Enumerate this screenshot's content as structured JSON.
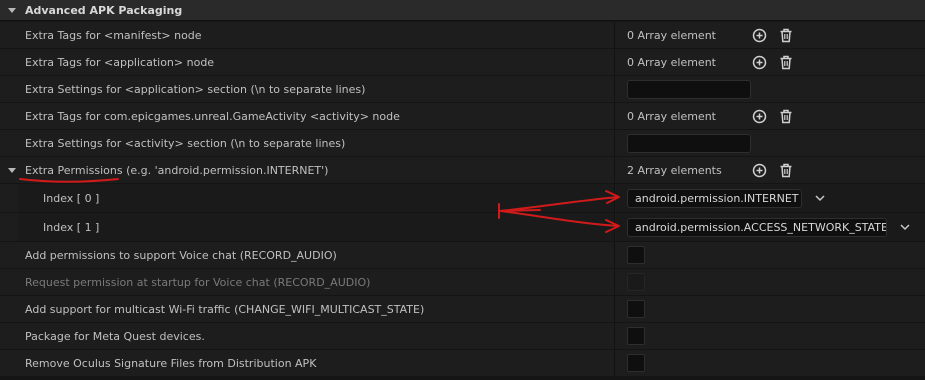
{
  "section": {
    "title": "Advanced APK Packaging"
  },
  "rows": {
    "manifest_tags": {
      "label": "Extra Tags for <manifest> node",
      "count": "0 Array element"
    },
    "application_tags": {
      "label": "Extra Tags for <application> node",
      "count": "0 Array element"
    },
    "application_settings": {
      "label": "Extra Settings for <application> section (\\n to separate lines)",
      "value": ""
    },
    "activity_tags": {
      "label": "Extra Tags for com.epicgames.unreal.GameActivity <activity> node",
      "count": "0 Array element"
    },
    "activity_settings": {
      "label": "Extra Settings for <activity> section (\\n to separate lines)",
      "value": ""
    },
    "extra_permissions": {
      "label": "Extra Permissions",
      "hint": " (e.g. 'android.permission.INTERNET')",
      "count": "2 Array elements",
      "items": [
        {
          "index_label": "Index [ 0 ]",
          "value": "android.permission.INTERNET"
        },
        {
          "index_label": "Index [ 1 ]",
          "value": "android.permission.ACCESS_NETWORK_STATE"
        }
      ]
    },
    "voice_chat": {
      "label": "Add permissions to support Voice chat (RECORD_AUDIO)",
      "checked": false
    },
    "voice_chat_startup": {
      "label": "Request permission at startup for Voice chat (RECORD_AUDIO)",
      "checked": false,
      "disabled": true
    },
    "multicast": {
      "label": "Add support for multicast Wi-Fi traffic (CHANGE_WIFI_MULTICAST_STATE)",
      "checked": false
    },
    "meta_quest": {
      "label": "Package for Meta Quest devices.",
      "checked": false
    },
    "oculus_signature": {
      "label": "Remove Oculus Signature Files from Distribution APK",
      "checked": false
    }
  },
  "colors": {
    "annotation": "#d11a1a",
    "panel": "#1d1d1d",
    "input": "#0f0f0f"
  },
  "icons": {
    "add": "add-circle-icon",
    "delete": "trash-icon",
    "expand": "caret-down-icon",
    "dropdown": "chevron-down-icon"
  }
}
